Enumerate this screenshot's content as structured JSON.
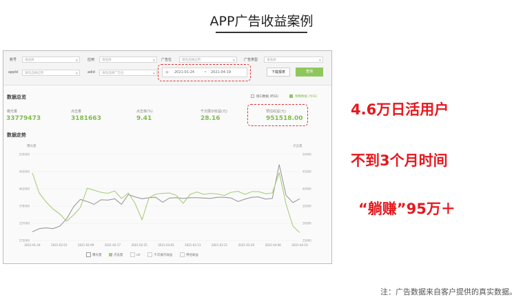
{
  "slide": {
    "title": "APP广告收益案例",
    "highlights": [
      "4.6万日活用户",
      "不到3个月时间",
      "“躺赚”95万＋"
    ],
    "footnote": "注：广告数据来自客户提供的真实数据。"
  },
  "filters": {
    "account": {
      "label": "账号",
      "placeholder": "请选择"
    },
    "application": {
      "label": "应用",
      "placeholder": "请选择"
    },
    "ad_slot": {
      "label": "广告位",
      "placeholder": "请先选择应用"
    },
    "ad_type": {
      "label": "广告类型",
      "placeholder": "请选择"
    },
    "appid": {
      "label": "appId",
      "placeholder": "请先选择应用"
    },
    "adid": {
      "label": "adid",
      "placeholder": "请先选择广告位"
    },
    "date_start": "2021-01-24",
    "date_sep": "~",
    "date_end": "2021-04-19",
    "download_label": "下载报表",
    "query_label": "查询"
  },
  "overview": {
    "title": "数据总览",
    "toggle_api": "接口数据",
    "toggle_api_note": "(昨日)",
    "toggle_estimated": "预算数据",
    "toggle_estimated_note": "(今日)",
    "metrics": [
      {
        "label": "曝光量",
        "value": "33779473"
      },
      {
        "label": "点击量",
        "value": "3181663"
      },
      {
        "label": "点击率(%)",
        "value": "9.41"
      },
      {
        "label": "千次展示收益(元)",
        "value": "28.16"
      },
      {
        "label": "预估收益(元)",
        "value": "951518.00"
      }
    ]
  },
  "trend": {
    "title": "数据走势",
    "left_axis_title": "曝光量",
    "right_axis_title": "点击量",
    "legend": [
      "曝光量",
      "点击量",
      "ctr",
      "千次展示收益",
      "预估收益"
    ]
  },
  "chart_data": {
    "type": "line",
    "x_ticks": [
      "2021-01-24",
      "2021-02-01",
      "2021-02-09",
      "2021-02-17",
      "2021-02-25",
      "2021-03-05",
      "2021-03-13",
      "2021-03-21",
      "2021-03-29",
      "2021-04-06",
      "2021-04-19"
    ],
    "y_left_ticks": [
      "275000",
      "337000",
      "378000",
      "463000",
      "493000",
      "520000"
    ],
    "y_right_ticks": [
      "25000",
      "30000",
      "35000",
      "40000",
      "45000",
      "50000"
    ],
    "ylim_left": [
      275000,
      520000
    ],
    "ylim_right": [
      25000,
      50000
    ],
    "series": [
      {
        "name": "曝光量",
        "color": "#9a9a9a",
        "axis": "left",
        "values": [
          300000,
          309000,
          311000,
          309000,
          316000,
          337000,
          371000,
          392000,
          386000,
          378000,
          391000,
          390000,
          394000,
          378000,
          406000,
          399000,
          394000,
          397000,
          398000,
          384000,
          396000,
          397000,
          395000,
          397000,
          397000,
          396000,
          395000,
          398000,
          398000,
          396000,
          386000,
          393000,
          398000,
          399000,
          393000,
          395000,
          491000,
          404000,
          383000,
          394000
        ]
      },
      {
        "name": "点击量",
        "color": "#a8cc78",
        "axis": "right",
        "values": [
          44600,
          38800,
          36200,
          34200,
          32700,
          30600,
          32400,
          34600,
          40200,
          39600,
          39000,
          38700,
          39400,
          37200,
          38800,
          35700,
          31000,
          37400,
          38500,
          38700,
          38800,
          38100,
          35800,
          38400,
          39100,
          38400,
          38700,
          38500,
          38100,
          39000,
          39300,
          38400,
          39200,
          39200,
          38600,
          38800,
          44700,
          35600,
          29200,
          27300
        ]
      }
    ]
  }
}
